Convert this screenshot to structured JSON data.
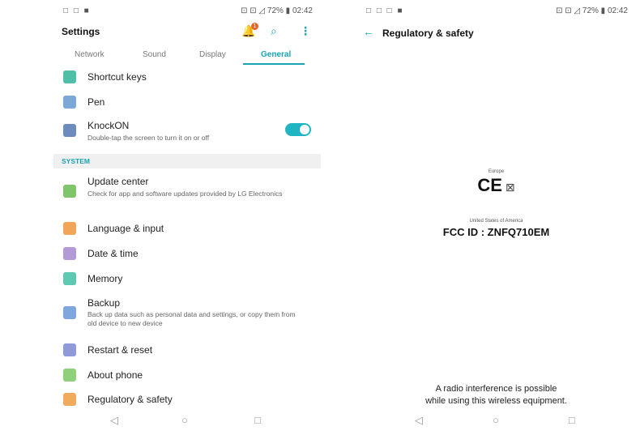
{
  "left": {
    "status_left": "□ □ ■",
    "status_right": "⊡ ⊡ ◿ 72% ▮ 02:42",
    "title": "Settings",
    "notif_count": "1",
    "tabs": [
      {
        "label": "Network"
      },
      {
        "label": "Sound"
      },
      {
        "label": "Display"
      },
      {
        "label": "General"
      }
    ],
    "active_tab": "General",
    "items_top": [
      {
        "label": "Shortcut keys"
      },
      {
        "label": "Pen"
      },
      {
        "label": "KnockON",
        "sub": "Double-tap the screen to turn it on or off",
        "toggle_on": true
      }
    ],
    "section_label": "SYSTEM",
    "items_system": [
      {
        "label": "Update center",
        "sub": "Check for app and software updates provided by LG Electronics"
      },
      {
        "label": "Language & input"
      },
      {
        "label": "Date & time"
      },
      {
        "label": "Memory"
      },
      {
        "label": "Backup",
        "sub": "Back up data such as personal data and settings, or copy them from old device to new device"
      },
      {
        "label": "Restart & reset"
      },
      {
        "label": "About phone"
      },
      {
        "label": "Regulatory & safety"
      }
    ],
    "nav": {
      "back": "◁",
      "home": "○",
      "recent": "□"
    },
    "accent": "#1aa3b3"
  },
  "right": {
    "status_left": "□ □ □ ■",
    "status_right": "⊡ ⊡ ◿ 72% ▮ 02:42",
    "title": "Regulatory & safety",
    "europe_label": "Europe",
    "ce_mark": "CE",
    "weee_symbol": "⊠",
    "usa_label": "United States of America",
    "fcc_id": "FCC ID : ZNFQ710EM",
    "radio_line1": "A radio interference is possible",
    "radio_line2": "while using this wireless equipment.",
    "nav": {
      "back": "◁",
      "home": "○",
      "recent": "□"
    }
  }
}
